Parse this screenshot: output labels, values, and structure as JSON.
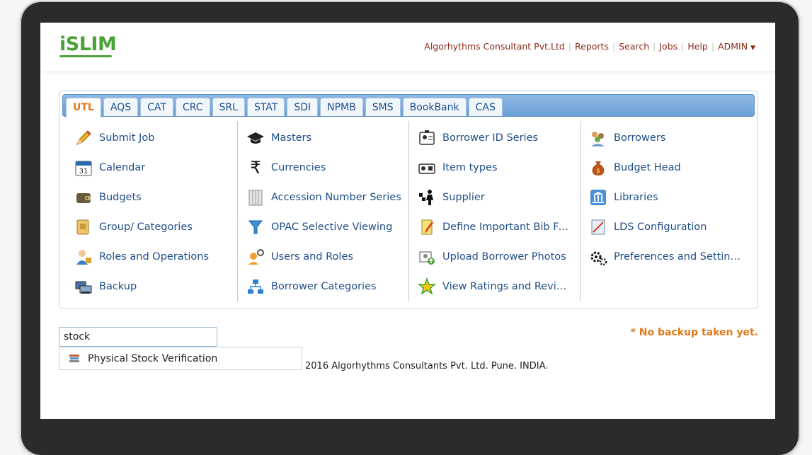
{
  "app": {
    "logo": "iSLIM",
    "brand_color": "#4ba338",
    "accent_color": "#e07a1a"
  },
  "topnav": {
    "company": "Algorhythms Consultant Pvt.Ltd",
    "reports": "Reports",
    "search": "Search",
    "jobs": "Jobs",
    "help": "Help",
    "user": "ADMIN"
  },
  "tabs": [
    {
      "label": "UTL",
      "active": true
    },
    {
      "label": "AQS"
    },
    {
      "label": "CAT"
    },
    {
      "label": "CRC"
    },
    {
      "label": "SRL"
    },
    {
      "label": "STAT"
    },
    {
      "label": "SDI"
    },
    {
      "label": "NPMB"
    },
    {
      "label": "SMS"
    },
    {
      "label": "BookBank"
    },
    {
      "label": "CAS"
    }
  ],
  "menu": {
    "col1": [
      {
        "label": "Submit Job",
        "icon": "pencil-icon"
      },
      {
        "label": "Calendar",
        "icon": "calendar-icon"
      },
      {
        "label": "Budgets",
        "icon": "wallet-icon"
      },
      {
        "label": "Group/ Categories",
        "icon": "folder-icon"
      },
      {
        "label": "Roles and Operations",
        "icon": "user-role-icon"
      },
      {
        "label": "Backup",
        "icon": "backup-icon"
      }
    ],
    "col2": [
      {
        "label": "Masters",
        "icon": "graduation-cap-icon"
      },
      {
        "label": "Currencies",
        "icon": "rupee-icon"
      },
      {
        "label": "Accession Number Series",
        "icon": "books-icon"
      },
      {
        "label": "OPAC Selective Viewing",
        "icon": "funnel-icon"
      },
      {
        "label": "Users and Roles",
        "icon": "user-gear-icon"
      },
      {
        "label": "Borrower Categories",
        "icon": "hierarchy-icon"
      }
    ],
    "col3": [
      {
        "label": "Borrower ID Series",
        "icon": "id-card-icon"
      },
      {
        "label": "Item types",
        "icon": "camera-icon"
      },
      {
        "label": "Supplier",
        "icon": "supplier-icon"
      },
      {
        "label": "Define Important Bib Fields",
        "icon": "notepad-icon"
      },
      {
        "label": "Upload Borrower Photos",
        "icon": "upload-photo-icon"
      },
      {
        "label": "View Ratings and Reviews",
        "icon": "star-icon"
      }
    ],
    "col4": [
      {
        "label": "Borrowers",
        "icon": "users-icon"
      },
      {
        "label": "Budget Head",
        "icon": "money-bag-icon"
      },
      {
        "label": "Libraries",
        "icon": "library-icon"
      },
      {
        "label": "LDS Configuration",
        "icon": "config-icon"
      },
      {
        "label": "Preferences and Settings",
        "icon": "gears-icon"
      }
    ]
  },
  "search": {
    "value": "stock"
  },
  "suggestion": {
    "label": "Physical Stock Verification",
    "icon": "stack-icon"
  },
  "footer": {
    "copyright": "2016 Algorhythms Consultants Pvt. Ltd. Pune. INDIA."
  },
  "warning": "* No backup taken yet."
}
